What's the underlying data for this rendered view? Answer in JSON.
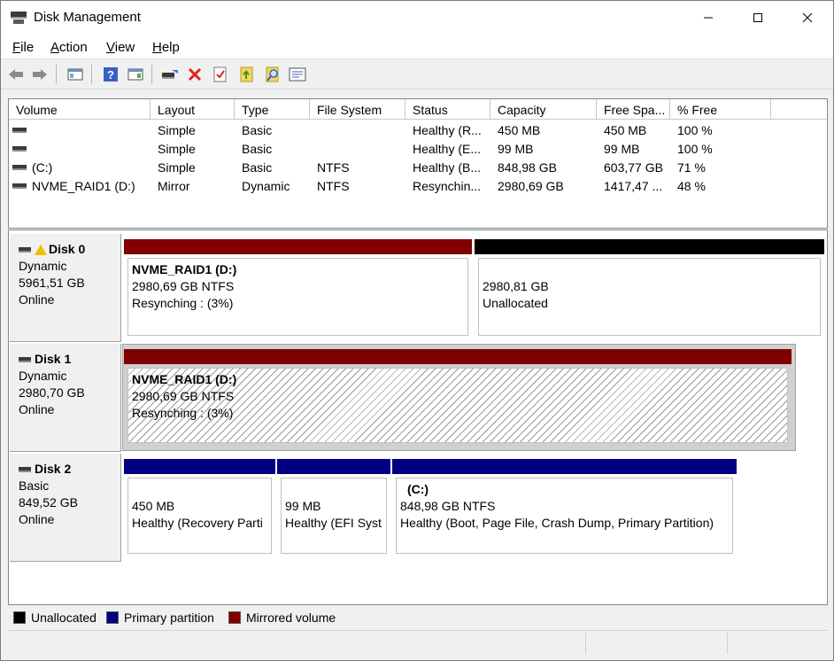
{
  "window": {
    "title": "Disk Management"
  },
  "menu": [
    {
      "label": "File",
      "accel": "F",
      "rest": "ile"
    },
    {
      "label": "Action",
      "accel": "A",
      "rest": "ction"
    },
    {
      "label": "View",
      "accel": "V",
      "rest": "iew"
    },
    {
      "label": "Help",
      "accel": "H",
      "rest": "elp"
    }
  ],
  "toolbar": [
    "back-icon",
    "forward-icon",
    "show-hide-console-tree-icon",
    "help-icon",
    "show-hide-action-pane-icon",
    "connect-disk-icon",
    "delete-icon",
    "checklist-icon",
    "import-icon",
    "search-icon",
    "properties-icon"
  ],
  "columns": [
    "Volume",
    "Layout",
    "Type",
    "File System",
    "Status",
    "Capacity",
    "Free Spa...",
    "% Free"
  ],
  "volumes": [
    {
      "volume": "",
      "layout": "Simple",
      "type": "Basic",
      "fs": "",
      "status": "Healthy (R...",
      "capacity": "450 MB",
      "free": "450 MB",
      "pct": "100 %"
    },
    {
      "volume": "",
      "layout": "Simple",
      "type": "Basic",
      "fs": "",
      "status": "Healthy (E...",
      "capacity": "99 MB",
      "free": "99 MB",
      "pct": "100 %"
    },
    {
      "volume": "(C:)",
      "layout": "Simple",
      "type": "Basic",
      "fs": "NTFS",
      "status": "Healthy (B...",
      "capacity": "848,98 GB",
      "free": "603,77 GB",
      "pct": "71 %"
    },
    {
      "volume": "NVME_RAID1 (D:)",
      "layout": "Mirror",
      "type": "Dynamic",
      "fs": "NTFS",
      "status": "Resynchin...",
      "capacity": "2980,69 GB",
      "free": "1417,47 ...",
      "pct": "48 %"
    }
  ],
  "disks": [
    {
      "name": "Disk 0",
      "type": "Dynamic",
      "size": "5961,51 GB",
      "state": "Online",
      "warning": true,
      "partitions": [
        {
          "title": "NVME_RAID1  (D:)",
          "line1": "2980,69 GB NTFS",
          "line2": "Resynching : (3%)",
          "kind": "mirrored"
        },
        {
          "title": "",
          "line1": "2980,81 GB",
          "line2": "Unallocated",
          "kind": "unallocated"
        }
      ]
    },
    {
      "name": "Disk 1",
      "type": "Dynamic",
      "size": "2980,70 GB",
      "state": "Online",
      "warning": false,
      "partitions": [
        {
          "title": "NVME_RAID1  (D:)",
          "line1": "2980,69 GB NTFS",
          "line2": "Resynching : (3%)",
          "kind": "mirrored"
        }
      ]
    },
    {
      "name": "Disk 2",
      "type": "Basic",
      "size": "849,52 GB",
      "state": "Online",
      "warning": false,
      "partitions": [
        {
          "title": "",
          "line1": "450 MB",
          "line2": "Healthy (Recovery Parti",
          "kind": "primary"
        },
        {
          "title": "",
          "line1": "99 MB",
          "line2": "Healthy (EFI Syst",
          "kind": "primary"
        },
        {
          "title": "(C:)",
          "line1": "848,98 GB NTFS",
          "line2": "Healthy (Boot, Page File, Crash Dump, Primary Partition)",
          "kind": "primary"
        }
      ]
    }
  ],
  "legend": [
    {
      "label": "Unallocated",
      "color": "#000000"
    },
    {
      "label": "Primary partition",
      "color": "#000080"
    },
    {
      "label": "Mirrored volume",
      "color": "#800000"
    }
  ],
  "colors": {
    "unallocated": "#000000",
    "primary": "#000080",
    "mirrored": "#800000"
  }
}
